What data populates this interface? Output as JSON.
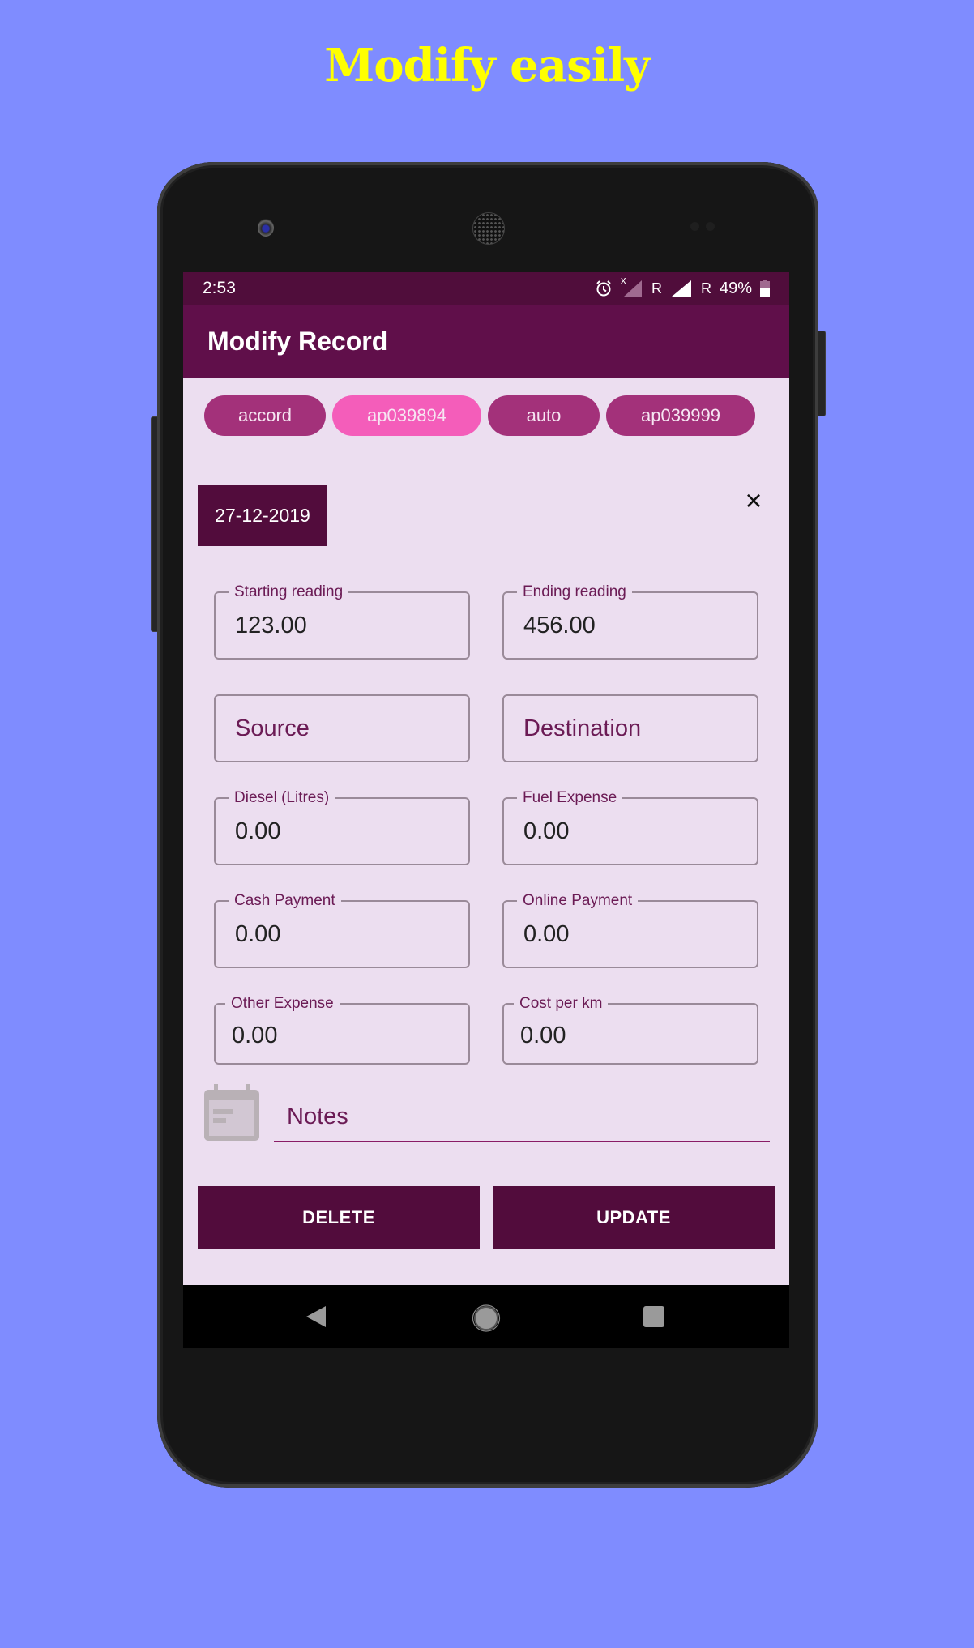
{
  "banner": {
    "title": "Modify easily"
  },
  "status_bar": {
    "time": "2:53",
    "icons": [
      "alarm-icon",
      "signal-no-sim-icon",
      "roaming-icon",
      "signal-icon",
      "roaming-icon",
      "battery-icon"
    ],
    "roaming_label_1": "R",
    "roaming_label_2": "R",
    "no_sim_mark": "x",
    "battery_percent": "49%"
  },
  "app_bar": {
    "title": "Modify Record"
  },
  "chips": [
    {
      "label": "accord",
      "selected": false
    },
    {
      "label": "ap039894",
      "selected": true
    },
    {
      "label": "auto",
      "selected": false
    },
    {
      "label": "ap039999",
      "selected": false
    }
  ],
  "date": {
    "value": "27-12-2019"
  },
  "close_icon": "×",
  "fields": {
    "starting_reading": {
      "label": "Starting reading",
      "value": "123.00"
    },
    "ending_reading": {
      "label": "Ending reading",
      "value": "456.00"
    },
    "source": {
      "placeholder": "Source"
    },
    "destination": {
      "placeholder": "Destination"
    },
    "diesel": {
      "label": "Diesel (Litres)",
      "value": "0.00"
    },
    "fuel_expense": {
      "label": "Fuel Expense",
      "value": "0.00"
    },
    "cash_payment": {
      "label": "Cash Payment",
      "value": "0.00"
    },
    "online_payment": {
      "label": "Online Payment",
      "value": "0.00"
    },
    "other_expense": {
      "label": "Other Expense",
      "value": "0.00"
    },
    "cost_per_km": {
      "label": "Cost per km",
      "value": "0.00"
    }
  },
  "notes": {
    "placeholder": "Notes"
  },
  "buttons": {
    "delete": "DELETE",
    "update": "UPDATE"
  },
  "colors": {
    "primary_dark": "#500d3b",
    "primary": "#600f4a",
    "chip": "#a3317a",
    "chip_selected": "#f45dba",
    "background": "#ecdef0",
    "page_bg": "#7f8cff",
    "banner_text": "#ffff00"
  }
}
